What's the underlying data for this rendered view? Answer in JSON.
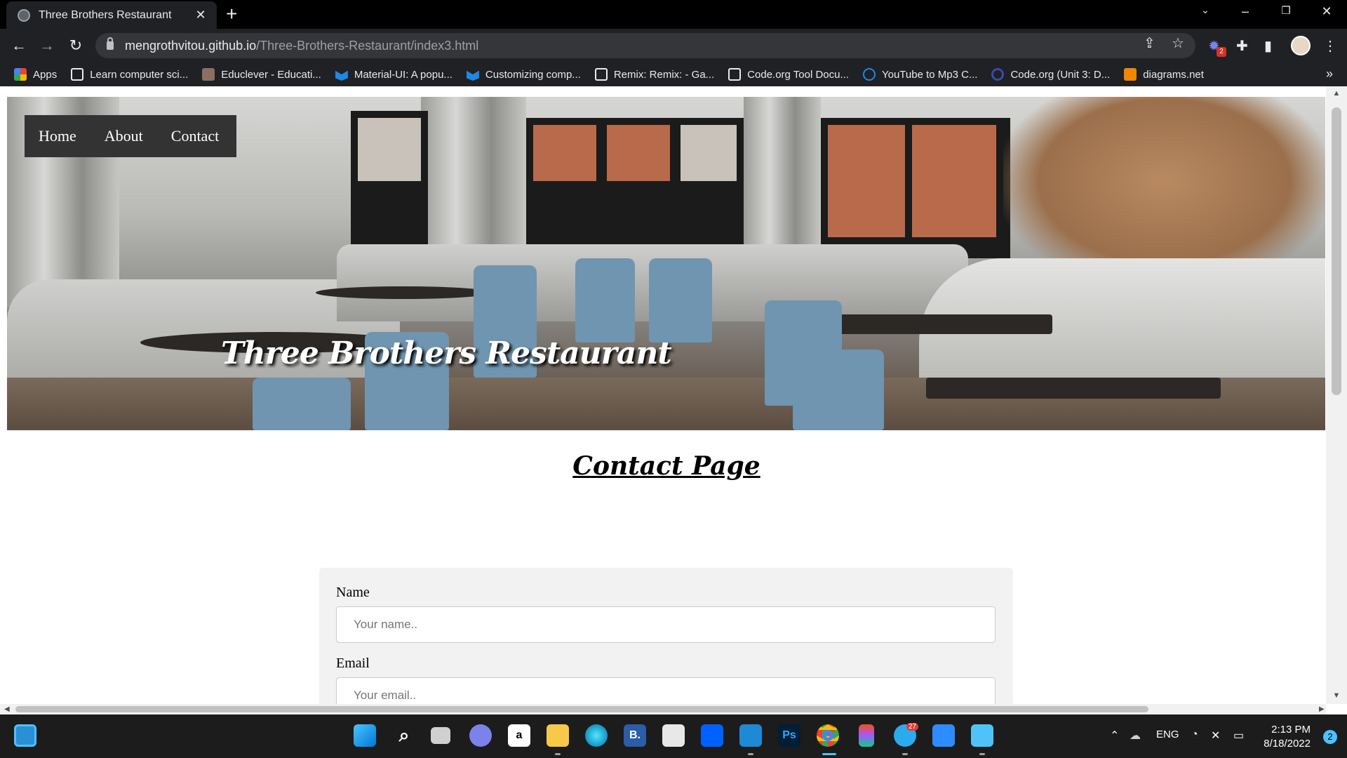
{
  "browser": {
    "tab_title": "Three Brothers Restaurant",
    "tab_close": "✕",
    "new_tab": "+",
    "url_host": "mengrothvitou.github.io",
    "url_path": "/Three-Brothers-Restaurant/index3.html",
    "extension_badge": "2",
    "bookmarks": [
      {
        "label": "Apps",
        "color": "#ea4335"
      },
      {
        "label": "Learn computer sci...",
        "color": "#e8eaed"
      },
      {
        "label": "Educlever - Educati...",
        "color": "#8d6e63"
      },
      {
        "label": "Material-UI: A popu...",
        "color": "#1e88e5"
      },
      {
        "label": "Customizing comp...",
        "color": "#1e88e5"
      },
      {
        "label": "Remix: Remix: - Ga...",
        "color": "#e8eaed"
      },
      {
        "label": "Code.org Tool Docu...",
        "color": "#e8eaed"
      },
      {
        "label": "YouTube to Mp3 C...",
        "color": "#1e88e5"
      },
      {
        "label": "Code.org (Unit 3: D...",
        "color": "#3949ab"
      },
      {
        "label": "diagrams.net",
        "color": "#f08705"
      }
    ],
    "bookmarks_more": "»"
  },
  "site": {
    "nav": [
      "Home",
      "About",
      "Contact"
    ],
    "hero_title": "Three Brothers Restaurant",
    "page_heading": "Contact Page",
    "form": {
      "name_label": "Name",
      "name_placeholder": "Your name..",
      "email_label": "Email",
      "email_placeholder": "Your email.."
    }
  },
  "taskbar": {
    "apps": [
      {
        "name": "start-icon",
        "glyph": "",
        "color": "#4cc2ff"
      },
      {
        "name": "search-icon",
        "glyph": "⌕",
        "color": "#1c1c1c"
      },
      {
        "name": "task-view-icon",
        "glyph": "",
        "color": "#d0d0d0"
      },
      {
        "name": "teams-chat-icon",
        "glyph": "",
        "color": "#7b83eb"
      },
      {
        "name": "amazon-icon",
        "glyph": "a",
        "color": "#ffffff"
      },
      {
        "name": "file-explorer-icon",
        "glyph": "",
        "color": "#f7c948"
      },
      {
        "name": "edge-icon",
        "glyph": "",
        "color": "#1da1c9"
      },
      {
        "name": "booking-icon",
        "glyph": "B.",
        "color": "#2b5da8"
      },
      {
        "name": "store-icon",
        "glyph": "",
        "color": "#e8e8e8"
      },
      {
        "name": "dropbox-icon",
        "glyph": "",
        "color": "#0061fe"
      },
      {
        "name": "vscode-icon",
        "glyph": "",
        "color": "#1e8ad6"
      },
      {
        "name": "photoshop-icon",
        "glyph": "Ps",
        "color": "#001e36"
      },
      {
        "name": "chrome-icon",
        "glyph": "",
        "color": "#ea4335"
      },
      {
        "name": "figma-icon",
        "glyph": "",
        "color": "#a259ff"
      },
      {
        "name": "telegram-icon",
        "glyph": "",
        "color": "#2aabee"
      },
      {
        "name": "zoom-icon",
        "glyph": "",
        "color": "#2d8cff"
      },
      {
        "name": "notepad-icon",
        "glyph": "",
        "color": "#4fc3f7"
      }
    ],
    "telegram_badge": "27",
    "language": "ENG",
    "time": "2:13 PM",
    "date": "8/18/2022",
    "notifications": "2"
  }
}
